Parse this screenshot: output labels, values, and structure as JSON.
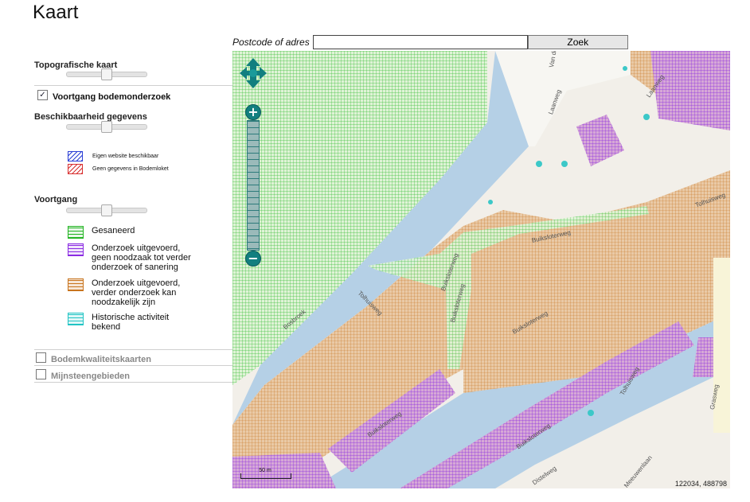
{
  "page": {
    "title": "Kaart"
  },
  "search": {
    "label": "Postcode of adres",
    "value": "",
    "placeholder": "",
    "button_label": "Zoek"
  },
  "sidebar": {
    "topo": {
      "title": "Topografische kaart",
      "opacity": 0.5
    },
    "voortgang_bodem": {
      "label": "Voortgang bodemonderzoek",
      "checked": true,
      "check_glyph": "✓"
    },
    "beschikbaarheid": {
      "title": "Beschikbaarheid gegevens",
      "opacity": 0.5,
      "legend": [
        {
          "label": "Eigen website beschikbaar",
          "color": "#2b3fd6"
        },
        {
          "label": "Geen gegevens in Bodemloket",
          "color": "#d83030"
        }
      ]
    },
    "voortgang": {
      "title": "Voortgang",
      "opacity": 0.5,
      "legend": [
        {
          "line1": "Gesaneerd",
          "line2": "",
          "line3": "",
          "color": "#22b422"
        },
        {
          "line1": "Onderzoek uitgevoerd,",
          "line2": "geen noodzaak tot verder",
          "line3": "onderzoek of sanering",
          "color": "#8a2be2"
        },
        {
          "line1": "Onderzoek uitgevoerd,",
          "line2": "verder onderzoek kan",
          "line3": "noodzakelijk zijn",
          "color": "#c8741e"
        },
        {
          "line1": "Historische activiteit",
          "line2": "bekend",
          "line3": "",
          "color": "#22c4c4"
        }
      ]
    },
    "bodemkwaliteit": {
      "label": "Bodemkwaliteitskaarten",
      "checked": false
    },
    "mijnsteen": {
      "label": "Mijnsteengebieden",
      "checked": false
    }
  },
  "map": {
    "scale_label": "50 m",
    "coordinates": "122034, 488798",
    "street_labels": [
      "Laanweg",
      "Laanweg",
      "Bosbroek",
      "Tolhuisweg",
      "Buiksloterweg",
      "Buiksloterweg",
      "Buiksloterweg",
      "Buiksloterweg",
      "Buiksloterweg",
      "Buiksloterweg",
      "Tolhuisweg",
      "Tolhuisweg",
      "Meeuwenlaan",
      "Grasweg",
      "Distelweg",
      "Van der Pek"
    ],
    "colors": {
      "water": "#b5d0e6",
      "land": "#f2efe9",
      "green": "#22b422",
      "purple": "#8a2be2",
      "orange": "#c8741e",
      "cyan": "#22c4c4",
      "control": "#127f7f"
    }
  }
}
